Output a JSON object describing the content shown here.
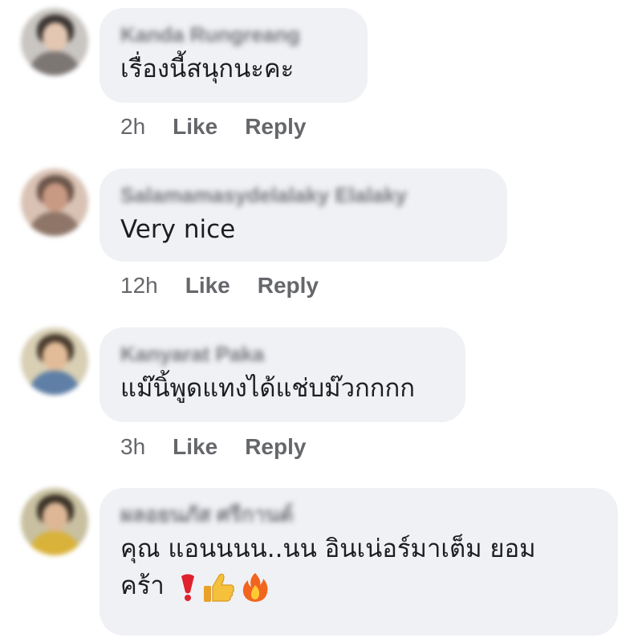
{
  "comments": [
    {
      "author": "Kanda Rungreang",
      "text": "เรื่องนี้สนุกนะคะ",
      "time": "2h",
      "like": "Like",
      "reply": "Reply"
    },
    {
      "author": "Salamamasydelalaky Elalaky",
      "text": "Very nice",
      "time": "12h",
      "like": "Like",
      "reply": "Reply"
    },
    {
      "author": "Kanyarat Paka",
      "text": "แม๊นิ้พูดแทงได้แช่บม๊วกกกก",
      "time": "3h",
      "like": "Like",
      "reply": "Reply"
    },
    {
      "author": "ผลอยนภัส ศรีกานต์",
      "text_line1": "คุณ แอนนนน..นน  อินเน่อร์มาเต็ม ยอม",
      "text_line2": "คร้า",
      "emojis": [
        "heavy-exclamation-icon",
        "thumbs-up-icon",
        "fire-icon"
      ]
    }
  ],
  "colors": {
    "bubble": "#f0f1f4",
    "meta": "#65676b",
    "text": "#1c1e21"
  }
}
